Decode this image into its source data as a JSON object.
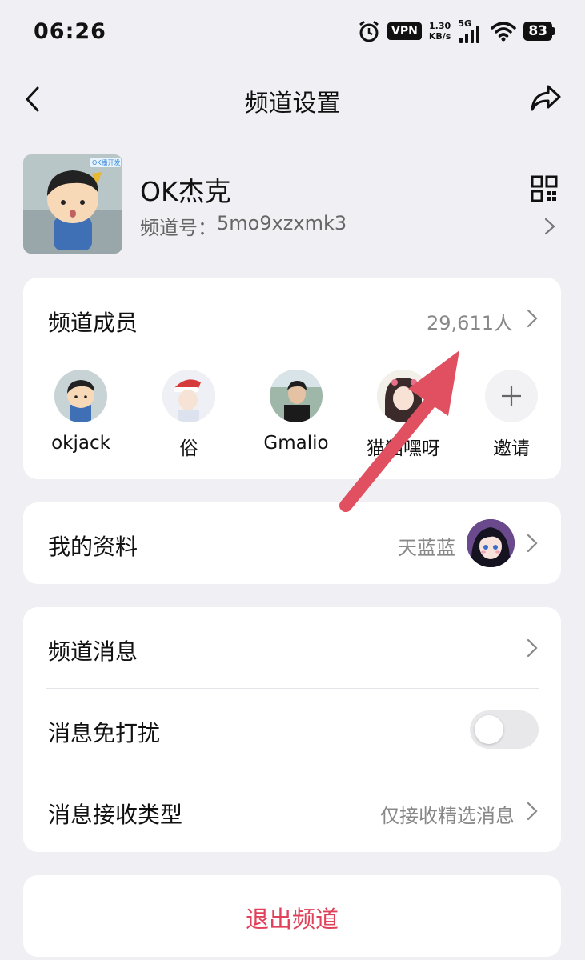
{
  "status_bar": {
    "time": "06:26",
    "vpn": "VPN",
    "speed_value": "1.30",
    "speed_unit": "KB/s",
    "network_type": "5G",
    "battery": "83",
    "icons": [
      "alarm-icon",
      "signal-icon",
      "wifi-icon",
      "battery-icon"
    ]
  },
  "nav": {
    "title": "频道设置",
    "back_icon": "chevron-left-icon",
    "share_icon": "share-icon"
  },
  "channel": {
    "name": "OK杰克",
    "id_label": "频道号：",
    "id_value": "5mo9xzxmk3",
    "avatar_badge": "OK播开发",
    "qr_icon": "qr-code-icon"
  },
  "members": {
    "title": "频道成员",
    "count": "29,611人",
    "list": [
      {
        "name": "okjack"
      },
      {
        "name": "俗"
      },
      {
        "name": "Gmalio"
      },
      {
        "name": "猫猫嘿呀"
      }
    ],
    "invite_label": "邀请"
  },
  "profile": {
    "title": "我的资料",
    "nickname": "天蓝蓝"
  },
  "settings": {
    "channel_messages": "频道消息",
    "do_not_disturb": "消息免打扰",
    "do_not_disturb_on": false,
    "receive_type": "消息接收类型",
    "receive_type_value": "仅接收精选消息"
  },
  "leave": {
    "label": "退出频道",
    "color": "#e0405a"
  },
  "annotation": {
    "arrow_color": "#e05060"
  }
}
